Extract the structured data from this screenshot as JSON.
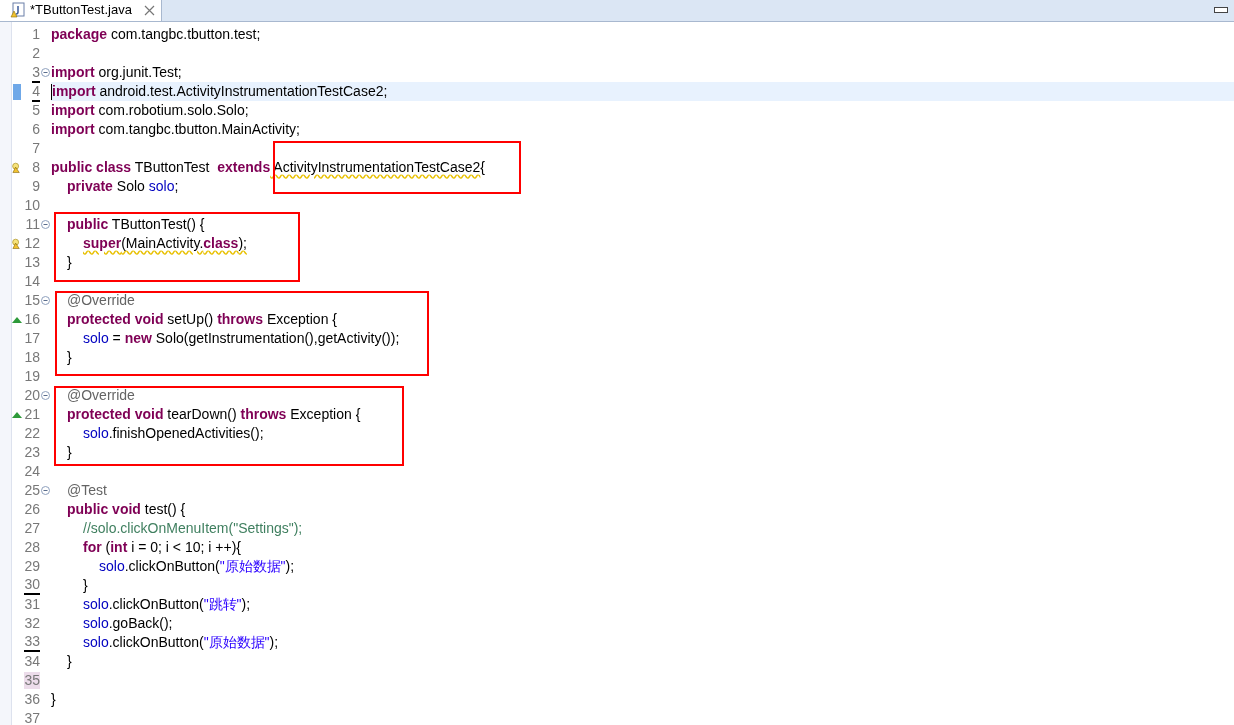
{
  "tab": {
    "title": "*TButtonTest.java"
  },
  "lines": [
    {
      "number": "1",
      "selected": false,
      "tokens": [
        {
          "kind": "keyword",
          "text": "package"
        },
        {
          "kind": "plain",
          "text": " com.tangbc.tbutton.test;"
        }
      ]
    },
    {
      "number": "2",
      "selected": false
    },
    {
      "number": "3",
      "selected": false,
      "fold": true,
      "tokens": [
        {
          "kind": "keyword",
          "text": "import"
        },
        {
          "kind": "plain",
          "text": " org.junit.Test;"
        }
      ]
    },
    {
      "number": "4",
      "selected": true,
      "tokens": [
        {
          "kind": "keyword",
          "text": "import"
        },
        {
          "kind": "plain",
          "text": " android.test.ActivityInstrumentationTestCase2;"
        }
      ]
    },
    {
      "number": "5",
      "selected": false,
      "tokens": [
        {
          "kind": "keyword",
          "text": "import"
        },
        {
          "kind": "plain",
          "text": " com.robotium.solo.Solo;"
        }
      ]
    },
    {
      "number": "6",
      "selected": false,
      "tokens": [
        {
          "kind": "keyword",
          "text": "import"
        },
        {
          "kind": "plain",
          "text": " com.tangbc.tbutton.MainActivity;"
        }
      ]
    },
    {
      "number": "7",
      "selected": false
    },
    {
      "number": "8",
      "selected": false,
      "warning": true,
      "tokens": [
        {
          "kind": "keyword",
          "text": "public class"
        },
        {
          "kind": "plain",
          "text": " TButtonTest  "
        },
        {
          "kind": "keyword",
          "text": "extends"
        },
        {
          "kind": "plain",
          "text": " ActivityInstrumentationTestCase2",
          "warning": true
        },
        {
          "kind": "plain",
          "text": "{"
        }
      ],
      "children": [
        {
          "number": "9",
          "selected": false,
          "tokens": [
            {
              "kind": "keyword",
              "text": "private"
            },
            {
              "kind": "plain",
              "text": " Solo "
            },
            {
              "kind": "field",
              "text": "solo"
            },
            {
              "kind": "plain",
              "text": ";"
            }
          ]
        },
        {
          "number": "10",
          "selected": false
        },
        {
          "number": "11",
          "selected": false,
          "fold": true,
          "tokens": [
            {
              "kind": "keyword",
              "text": "public"
            },
            {
              "kind": "plain",
              "text": " TButtonTest() {"
            }
          ],
          "children": [
            {
              "number": "12",
              "selected": false,
              "warning": true,
              "tokens": [
                {
                  "kind": "keyword",
                  "text": "super",
                  "warning": true
                },
                {
                  "kind": "plain",
                  "text": "(MainActivity.",
                  "warning": true
                },
                {
                  "kind": "keyword",
                  "text": "class",
                  "warning": true
                },
                {
                  "kind": "plain",
                  "text": ");",
                  "warning": true
                }
              ]
            }
          ]
        },
        {
          "number": "13",
          "selected": false,
          "tokens": [
            {
              "kind": "plain",
              "text": "}"
            }
          ]
        },
        {
          "number": "14",
          "selected": false
        },
        {
          "number": "15",
          "selected": false,
          "fold": true,
          "tokens": [
            {
              "kind": "annotation",
              "text": "@Override"
            }
          ]
        },
        {
          "number": "16",
          "selected": false,
          "overrides": true,
          "tokens": [
            {
              "kind": "keyword",
              "text": "protected void"
            },
            {
              "kind": "plain",
              "text": " setUp() "
            },
            {
              "kind": "keyword",
              "text": "throws"
            },
            {
              "kind": "plain",
              "text": " Exception {"
            }
          ],
          "children": [
            {
              "number": "17",
              "selected": false,
              "tokens": [
                {
                  "kind": "field",
                  "text": "solo"
                },
                {
                  "kind": "plain",
                  "text": " = "
                },
                {
                  "kind": "keyword",
                  "text": "new"
                },
                {
                  "kind": "plain",
                  "text": " Solo(getInstrumentation(),getActivity());"
                }
              ]
            }
          ]
        },
        {
          "number": "18",
          "selected": false,
          "tokens": [
            {
              "kind": "plain",
              "text": "}"
            }
          ]
        },
        {
          "number": "19",
          "selected": false
        },
        {
          "number": "20",
          "selected": false,
          "fold": true,
          "tokens": [
            {
              "kind": "annotation",
              "text": "@Override"
            }
          ]
        },
        {
          "number": "21",
          "selected": false,
          "overrides": true,
          "tokens": [
            {
              "kind": "keyword",
              "text": "protected void"
            },
            {
              "kind": "plain",
              "text": " tearDown() "
            },
            {
              "kind": "keyword",
              "text": "throws"
            },
            {
              "kind": "plain",
              "text": " Exception {"
            }
          ],
          "children": [
            {
              "number": "22",
              "selected": false,
              "tokens": [
                {
                  "kind": "field",
                  "text": "solo"
                },
                {
                  "kind": "plain",
                  "text": ".finishOpenedActivities();"
                }
              ]
            }
          ]
        },
        {
          "number": "23",
          "selected": false,
          "tokens": [
            {
              "kind": "plain",
              "text": "}"
            }
          ]
        },
        {
          "number": "24",
          "selected": false
        },
        {
          "number": "25",
          "selected": false,
          "fold": true,
          "tokens": [
            {
              "kind": "annotation",
              "text": "@Test"
            }
          ]
        },
        {
          "number": "26",
          "selected": false,
          "tokens": [
            {
              "kind": "keyword",
              "text": "public void"
            },
            {
              "kind": "plain",
              "text": " test() {"
            }
          ],
          "children": [
            {
              "number": "27",
              "selected": false,
              "tokens": [
                {
                  "kind": "comment",
                  "text": "//solo.clickOnMenuItem(\"Settings\");"
                }
              ]
            },
            {
              "number": "28",
              "selected": false,
              "tokens": [
                {
                  "kind": "keyword",
                  "text": "for"
                },
                {
                  "kind": "plain",
                  "text": " ("
                },
                {
                  "kind": "keyword",
                  "text": "int"
                },
                {
                  "kind": "plain",
                  "text": " i = 0; i < 10; i ++){"
                }
              ],
              "children": [
                {
                  "number": "29",
                  "selected": false,
                  "tokens": [
                    {
                      "kind": "field",
                      "text": "solo"
                    },
                    {
                      "kind": "plain",
                      "text": ".clickOnButton("
                    },
                    {
                      "kind": "string",
                      "text": "\"原始数据\""
                    },
                    {
                      "kind": "plain",
                      "text": ");"
                    }
                  ]
                }
              ]
            },
            {
              "number": "30",
              "selected": false,
              "changed": true,
              "tokens": [
                {
                  "kind": "plain",
                  "text": "}"
                }
              ]
            },
            {
              "number": "31",
              "selected": false,
              "tokens": [
                {
                  "kind": "field",
                  "text": "solo"
                },
                {
                  "kind": "plain",
                  "text": ".clickOnButton("
                },
                {
                  "kind": "string",
                  "text": "\"跳转\""
                },
                {
                  "kind": "plain",
                  "text": ");"
                }
              ]
            },
            {
              "number": "32",
              "selected": false,
              "tokens": [
                {
                  "kind": "field",
                  "text": "solo"
                },
                {
                  "kind": "plain",
                  "text": ".goBack();"
                }
              ]
            },
            {
              "number": "33",
              "selected": false,
              "changed": true,
              "tokens": [
                {
                  "kind": "field",
                  "text": "solo"
                },
                {
                  "kind": "plain",
                  "text": ".clickOnButton("
                },
                {
                  "kind": "string",
                  "text": "\"原始数据\""
                },
                {
                  "kind": "plain",
                  "text": ");"
                }
              ]
            }
          ]
        },
        {
          "number": "34",
          "selected": false,
          "tokens": [
            {
              "kind": "plain",
              "text": "}"
            }
          ]
        },
        {
          "number": "35",
          "selected": false,
          "marked": true
        }
      ]
    },
    {
      "number": "36",
      "selected": false,
      "tokens": [
        {
          "kind": "plain",
          "text": "}"
        }
      ]
    },
    {
      "number": "37",
      "selected": false
    }
  ]
}
